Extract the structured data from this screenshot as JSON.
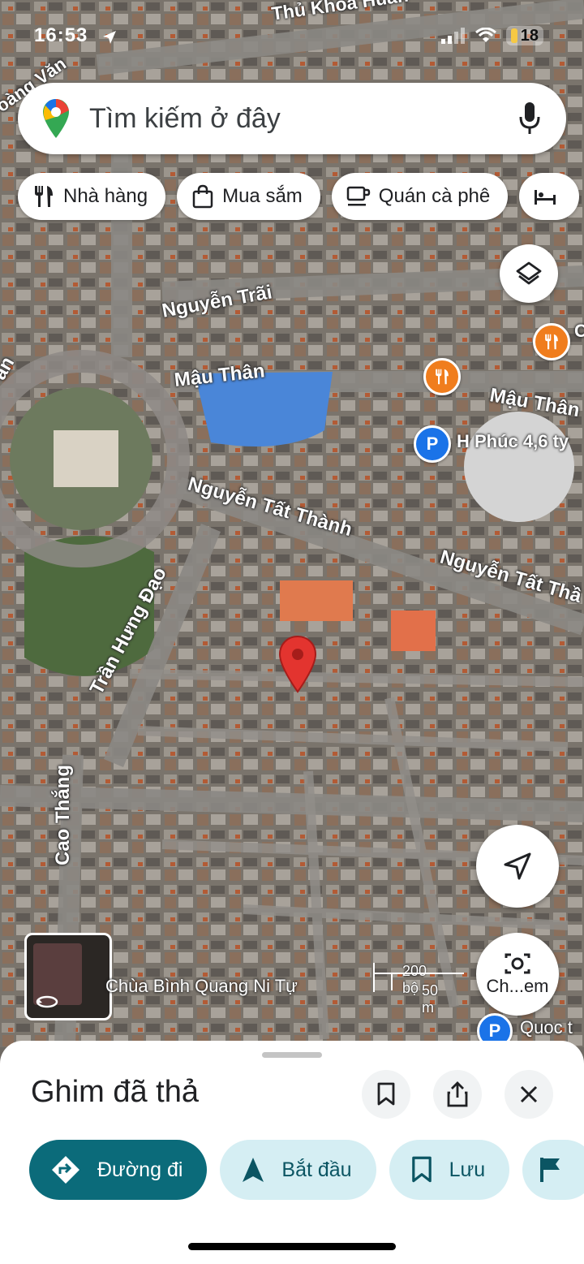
{
  "status_bar": {
    "time": "16:53",
    "battery": "18"
  },
  "search": {
    "placeholder": "Tìm kiếm ở đây"
  },
  "chips": [
    {
      "label": "Nhà hàng",
      "icon": "restaurant-icon"
    },
    {
      "label": "Mua sắm",
      "icon": "shopping-bag-icon"
    },
    {
      "label": "Quán cà phê",
      "icon": "coffee-cup-icon"
    }
  ],
  "map": {
    "roads": {
      "thu_khoa_huan": "Thủ Khoa Huân",
      "nguyen_trai": "Nguyễn Trãi",
      "mau_than_1": "Mậu Thân",
      "mau_than_2": "Mậu Thân",
      "nguyen_tat_thanh_1": "Nguyễn Tất Thành",
      "nguyen_tat_thanh_2": "Nguyễn Tất Thầ",
      "tran_hung_dao": "Trần Hưng Đạo",
      "cao_thang": "Cao Thắng",
      "hoang_van": "oàng Văn",
      "left_edge": "ần"
    },
    "pois": {
      "parking_1": "H Phúc 4,6 ty",
      "parking_2": "Quoc t",
      "street_view": "Chùa Bình Quang Ni Tự",
      "right_edge_poi": "C"
    },
    "scale": {
      "feet": "200 bộ",
      "meters": "50 m"
    },
    "camera_label": "Ch...em",
    "colors": {
      "accent": "#0b6b7a",
      "pin": "#e3342f",
      "poi_food": "#f07d1d",
      "parking": "#1a73e8"
    }
  },
  "sheet": {
    "title": "Ghim đã thả",
    "actions": [
      {
        "label": "Đường đi",
        "style": "primary"
      },
      {
        "label": "Bắt đầu",
        "style": "secondary"
      },
      {
        "label": "Lưu",
        "style": "secondary"
      }
    ]
  }
}
